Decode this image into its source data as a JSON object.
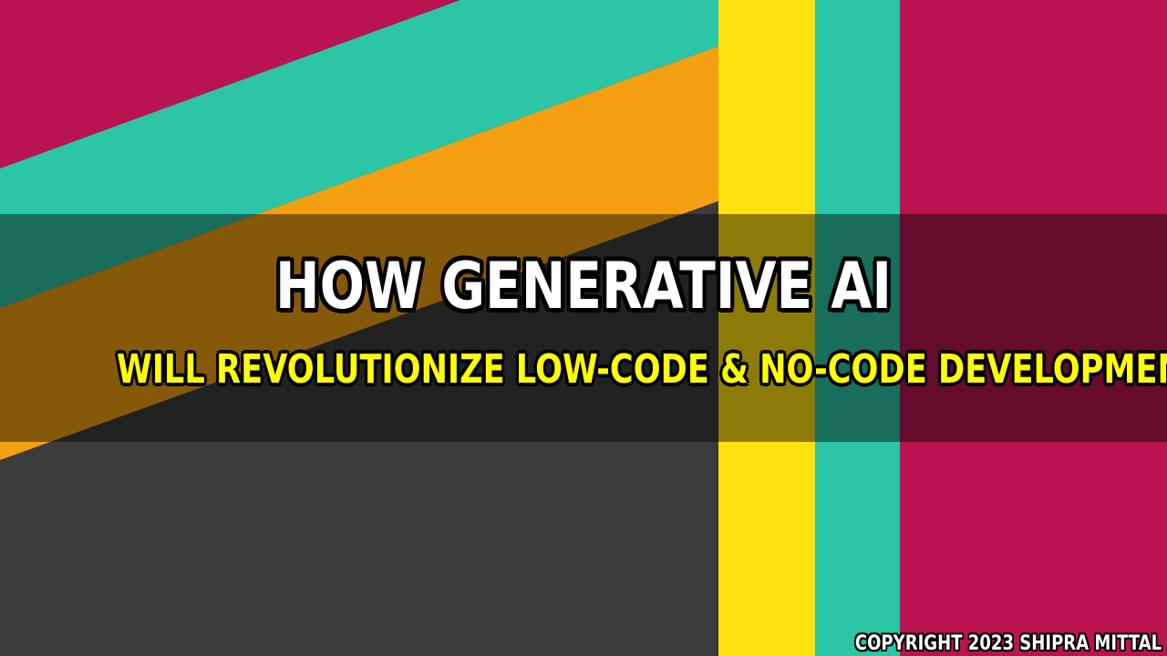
{
  "colors": {
    "background": "#3c3c3c",
    "magenta": "#b91450",
    "teal": "#2cc6a7",
    "orange": "#f5a013",
    "yellow": "#ffe10e",
    "dark": "#292929",
    "title_text": "#ffffff",
    "subtitle_text": "#ffff00"
  },
  "banner": {
    "title": "HOW GENERATIVE AI",
    "subtitle": "WILL REVOLUTIONIZE LOW-CODE & NO-CODE DEVELOPMENT"
  },
  "footer": {
    "copyright": "COPYRIGHT 2023 SHIPRA MITTAL"
  }
}
